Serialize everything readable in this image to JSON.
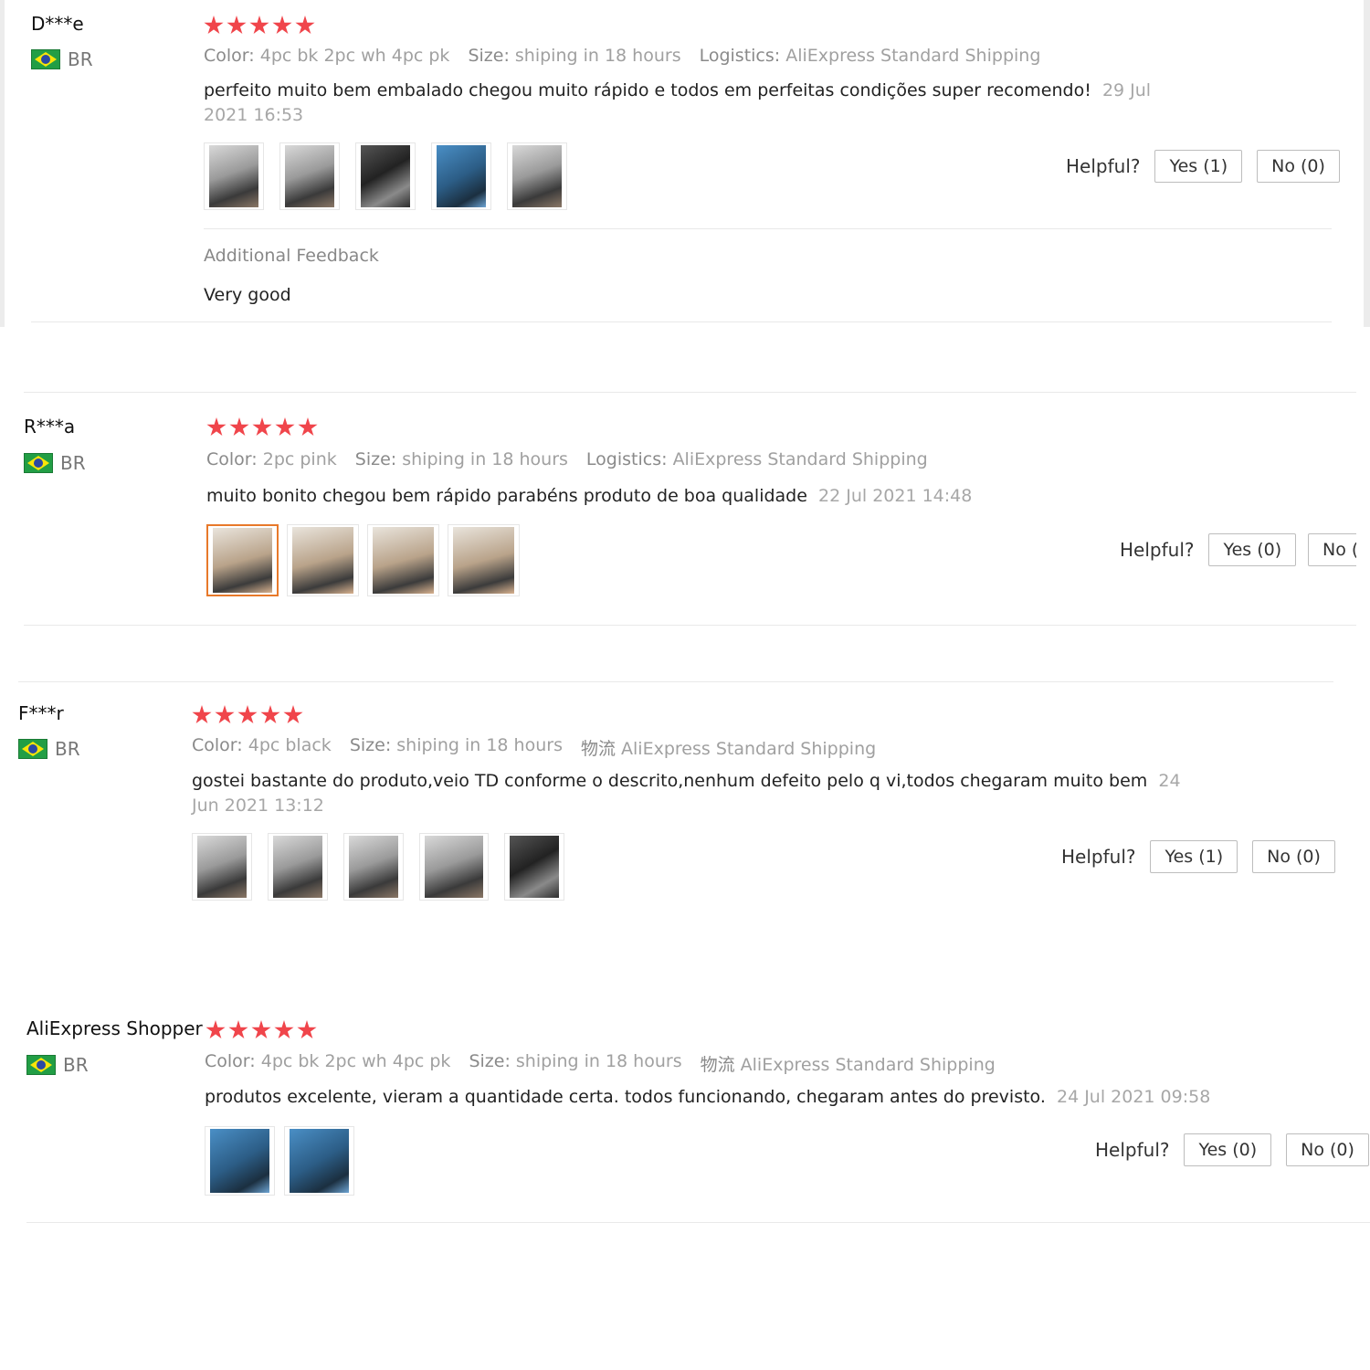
{
  "reviews": [
    {
      "name": "D***e",
      "country": "BR",
      "rating": 5,
      "color_label": "Color:",
      "color_value": "4pc bk 2pc wh 4pc pk",
      "size_label": "Size:",
      "size_value": "shiping in 18 hours",
      "logistics_label": "Logistics:",
      "logistics_value": "AliExpress Standard Shipping",
      "text": "perfeito muito bem embalado chegou muito rápido e todos em perfeitas condições super recomendo!",
      "date": "29 Jul 2021 16:53",
      "photo_count": 5,
      "helpful_label": "Helpful?",
      "yes_label": "Yes (1)",
      "no_label": "No (0)",
      "additional_title": "Additional Feedback",
      "additional_text": "Very good"
    },
    {
      "name": "R***a",
      "country": "BR",
      "rating": 5,
      "color_label": "Color:",
      "color_value": "2pc pink",
      "size_label": "Size:",
      "size_value": "shiping in 18 hours",
      "logistics_label": "Logistics:",
      "logistics_value": "AliExpress Standard Shipping",
      "text": "muito bonito chegou bem rápido parabéns produto de boa qualidade",
      "date": "22 Jul 2021 14:48",
      "photo_count": 4,
      "helpful_label": "Helpful?",
      "yes_label": "Yes (0)",
      "no_label": "No ("
    },
    {
      "name": "F***r",
      "country": "BR",
      "rating": 5,
      "color_label": "Color:",
      "color_value": "4pc black",
      "size_label": "Size:",
      "size_value": "shiping in 18 hours",
      "logistics_label": "物流",
      "logistics_value": "AliExpress Standard Shipping",
      "text": "gostei bastante do produto,veio TD conforme o descrito,nenhum defeito pelo q vi,todos chegaram muito bem",
      "date": "24 Jun 2021 13:12",
      "photo_count": 5,
      "helpful_label": "Helpful?",
      "yes_label": "Yes (1)",
      "no_label": "No (0)"
    },
    {
      "name": "AliExpress Shopper",
      "country": "BR",
      "rating": 5,
      "color_label": "Color:",
      "color_value": "4pc bk 2pc wh 4pc pk",
      "size_label": "Size:",
      "size_value": "shiping in 18 hours",
      "logistics_label": "物流",
      "logistics_value": "AliExpress Standard Shipping",
      "text": "produtos excelente, vieram a quantidade certa. todos funcionando, chegaram antes do previsto.",
      "date": "24 Jul 2021 09:58",
      "photo_count": 2,
      "helpful_label": "Helpful?",
      "yes_label": "Yes (0)",
      "no_label": "No (0)"
    }
  ],
  "colors": {
    "star": "#f0454b",
    "selected_thumb_border": "#e8792a",
    "divider": "#e9e9e9"
  }
}
